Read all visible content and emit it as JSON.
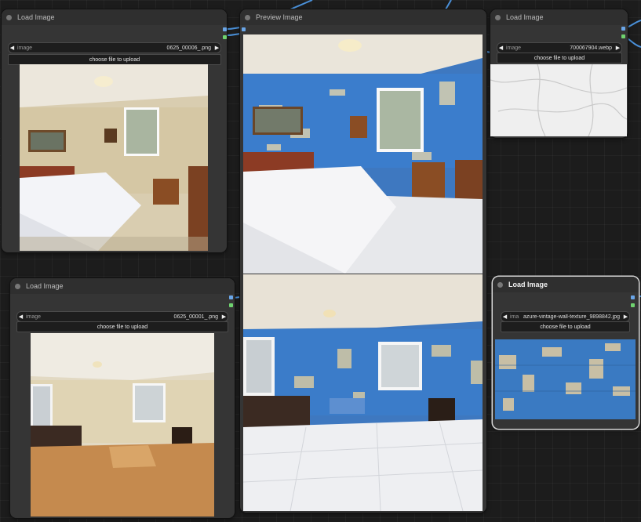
{
  "nodes": {
    "load1": {
      "title": "Load Image",
      "image_label": "image",
      "filename": "0625_00006_.png",
      "upload_label": "choose file to upload"
    },
    "load2": {
      "title": "Load Image",
      "image_label": "image",
      "filename": "0625_00001_.png",
      "upload_label": "choose file to upload"
    },
    "preview": {
      "title": "Preview Image"
    },
    "load3": {
      "title": "Load Image",
      "image_label": "image",
      "filename": "700067904.webp",
      "upload_label": "choose file to upload"
    },
    "load4": {
      "title": "Load Image",
      "image_label": "ima",
      "filename": "azure-vintage-wall-texture_9898842.jpg",
      "upload_label": "choose file to upload"
    }
  },
  "colors": {
    "wire": "#4a90d9",
    "canvas": "#1c1c1c",
    "node": "#353535",
    "port_image": "#6aa6e8",
    "port_mask": "#6fd36f"
  },
  "icons": [
    "arrow-left-icon",
    "arrow-right-icon",
    "node-dot-icon"
  ]
}
